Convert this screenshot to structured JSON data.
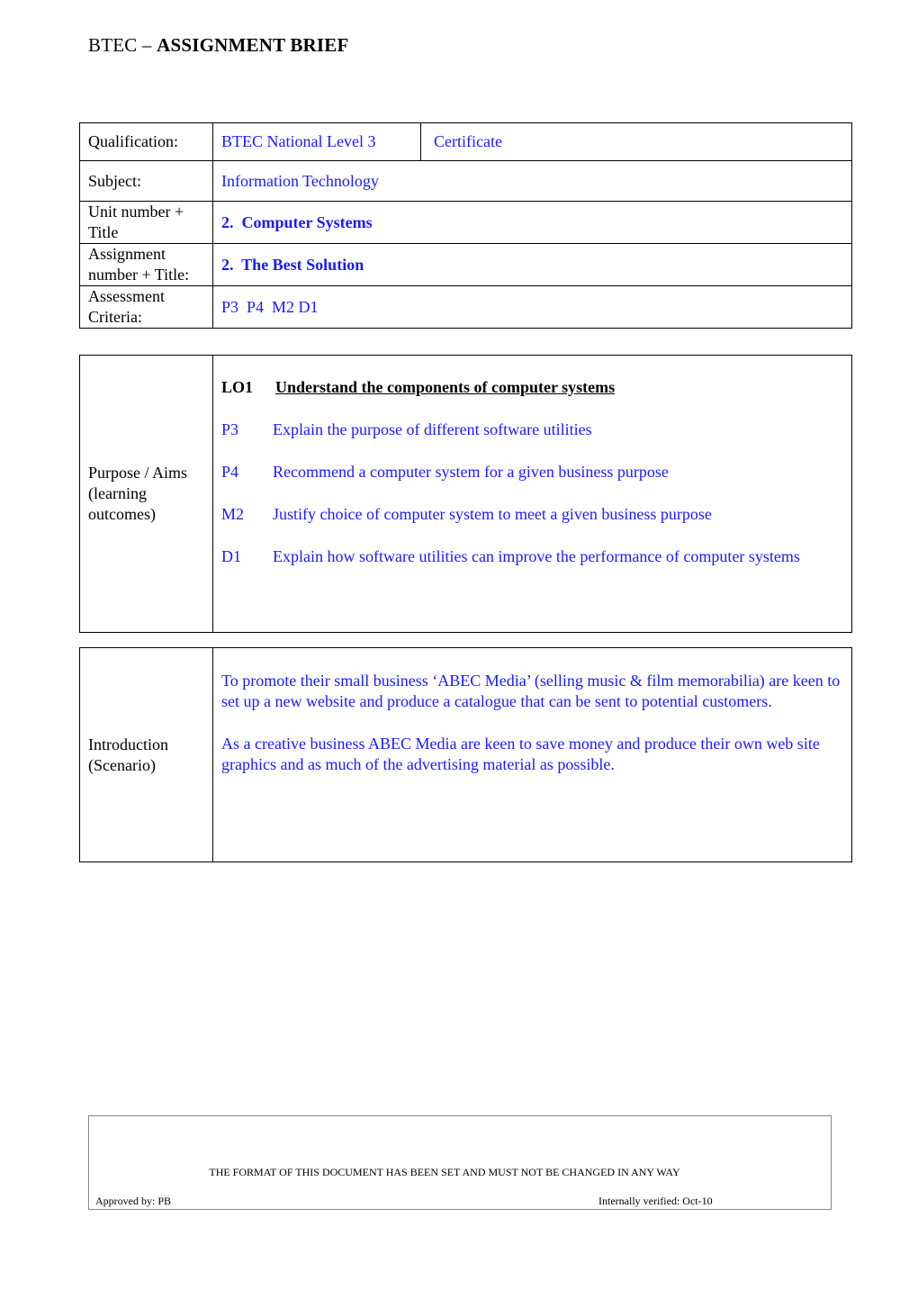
{
  "header": {
    "prefix": "BTEC – ",
    "title_bold": "ASSIGNMENT BRIEF"
  },
  "details": {
    "qualification_label": "Qualification:",
    "qualification_value": "BTEC National Level 3",
    "qualification_type": "Certificate",
    "subject_label": "Subject:",
    "subject_value": "Information Technology",
    "unit_label": "Unit number + Title",
    "unit_value": "2.  Computer Systems",
    "assignment_label": "Assignment number + Title:",
    "assignment_value": "2.  The Best Solution",
    "criteria_label": "Assessment Criteria:",
    "criteria_value": "P3  P4  M2 D1"
  },
  "purpose": {
    "label": "Purpose / Aims (learning outcomes)",
    "lo_code": "LO1",
    "lo_text": "Understand the components of computer systems",
    "criteria": [
      {
        "code": "P3",
        "text": "Explain the purpose of different software utilities"
      },
      {
        "code": "P4",
        "text": "Recommend a computer system for a given business purpose"
      },
      {
        "code": "M2",
        "text": "Justify choice of computer system to meet a given business purpose"
      },
      {
        "code": "D1",
        "text": "Explain how software utilities can improve the performance of computer systems"
      }
    ]
  },
  "introduction": {
    "label": "Introduction (Scenario)",
    "paragraphs": [
      "To promote their small business ‘ABEC Media’ (selling music & film memorabilia) are keen to set up a new website and produce a catalogue that can be sent to potential customers.",
      "As a creative business ABEC Media are keen to save money and produce their own web site graphics and as much of the advertising material as possible."
    ]
  },
  "footer": {
    "notice": "THE FORMAT OF THIS DOCUMENT HAS BEEN SET AND MUST NOT BE CHANGED IN ANY WAY",
    "approved": "Approved by: PB",
    "verified": "Internally verified: Oct-10"
  },
  "colors": {
    "value_text": "#1a1aff",
    "label_text": "#000000"
  }
}
